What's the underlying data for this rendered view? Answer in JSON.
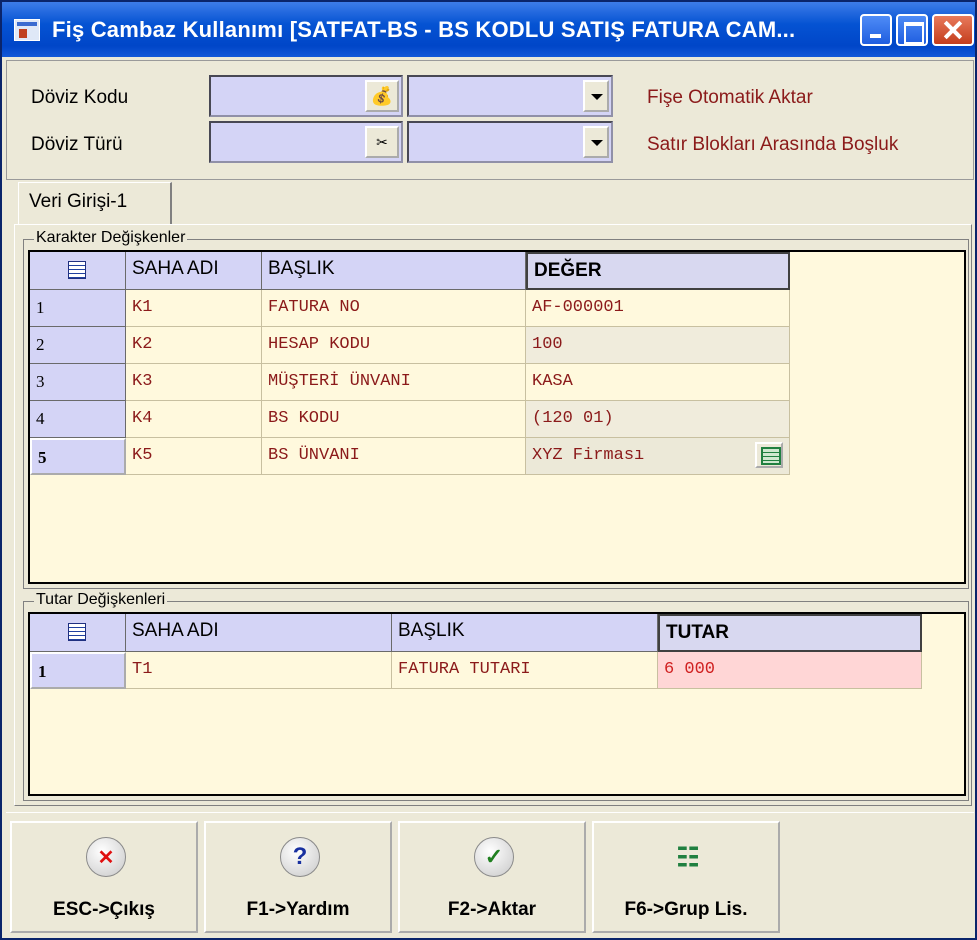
{
  "window": {
    "title": "Fiş Cambaz Kullanımı [SATFAT-BS - BS KODLU SATIŞ FATURA CAM..."
  },
  "form": {
    "doviz_kodu_label": "Döviz Kodu",
    "doviz_turu_label": "Döviz Türü",
    "doviz_kodu_value": "",
    "doviz_turu_value": "",
    "fise_otomatik_aktar": "Fişe Otomatik Aktar",
    "satir_bloklari": "Satır Blokları Arasında Boşluk"
  },
  "tabs": [
    {
      "label": "Veri Girişi-1"
    }
  ],
  "karakter": {
    "title": "Karakter Değişkenler",
    "headers": [
      "SAHA ADI",
      "BAŞLIK",
      "DEĞER"
    ],
    "rows": [
      {
        "num": "1",
        "saha": "K1",
        "baslik": "FATURA NO",
        "deger": "AF-000001"
      },
      {
        "num": "2",
        "saha": "K2",
        "baslik": "HESAP KODU",
        "deger": "100"
      },
      {
        "num": "3",
        "saha": "K3",
        "baslik": "MÜŞTERİ ÜNVANI",
        "deger": "KASA"
      },
      {
        "num": "4",
        "saha": "K4",
        "baslik": "BS KODU",
        "deger": "(120 01)"
      },
      {
        "num": "5",
        "saha": "K5",
        "baslik": "BS ÜNVANI",
        "deger": "XYZ Firması"
      }
    ]
  },
  "tutar": {
    "title": "Tutar Değişkenleri",
    "headers": [
      "SAHA ADI",
      "BAŞLIK",
      "TUTAR"
    ],
    "rows": [
      {
        "num": "1",
        "saha": "T1",
        "baslik": "FATURA TUTARI",
        "tutar": "6 000"
      }
    ]
  },
  "buttons": {
    "esc": "ESC->Çıkış",
    "f1": "F1->Yardım",
    "f2": "F2->Aktar",
    "f6": "F6->Grup Lis."
  },
  "icons": {
    "app": "app-window-icon",
    "esc": "close-icon",
    "f1": "help-icon",
    "f2": "check-icon",
    "f6": "tree-icon"
  },
  "colors": {
    "titlebar": "#0553d3",
    "grid_bg": "#fff9dd",
    "header_bg": "#d4d4f6",
    "red_text": "#8b1a1a",
    "tutar_cell_bg": "#ffd6d6"
  }
}
